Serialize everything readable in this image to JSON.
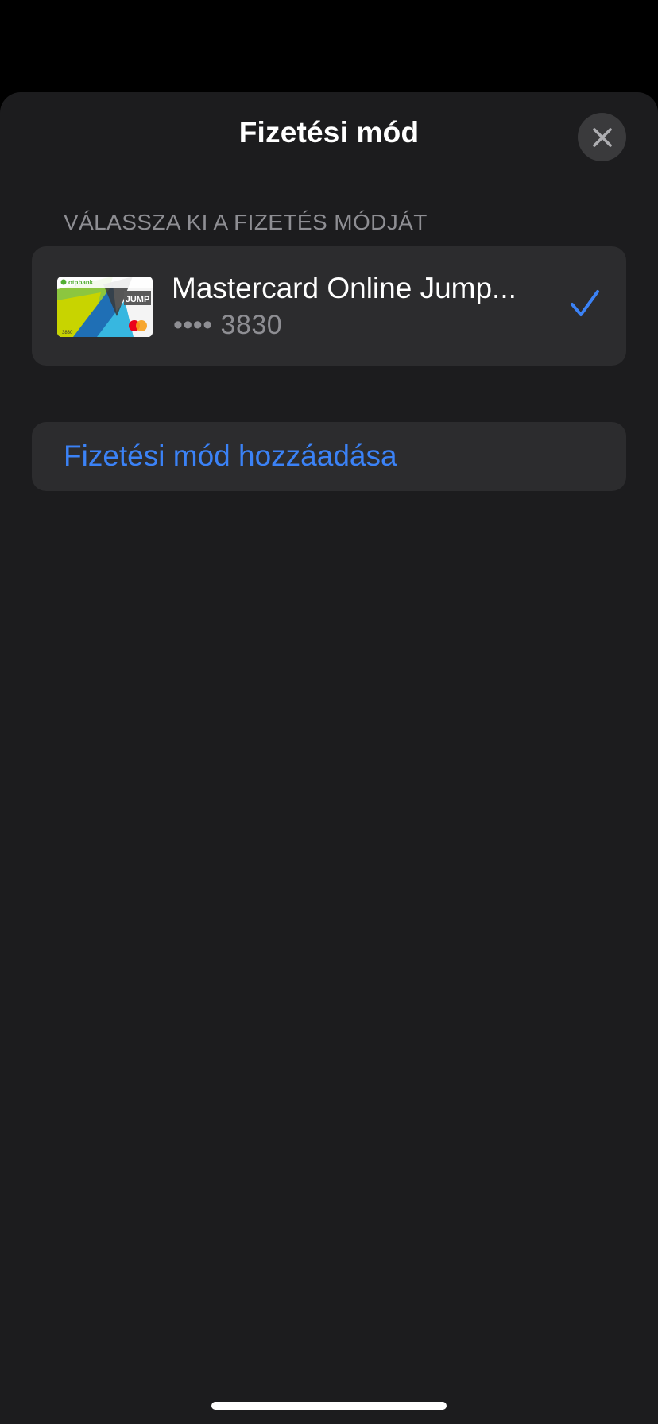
{
  "sheet": {
    "title": "Fizetési mód",
    "close_icon": "close-icon"
  },
  "payment": {
    "section_header": "VÁLASSZA KI A FIZETÉS MÓDJÁT",
    "methods": [
      {
        "name": "Mastercard Online Jump...",
        "number": "•••• 3830",
        "selected": true,
        "card_bank_logo": "otpbank",
        "card_brand_text": "JUMP",
        "card_small_number": "3830"
      }
    ],
    "add_label": "Fizetési mód hozzáadása"
  },
  "colors": {
    "background": "#000000",
    "sheet": "#1c1c1e",
    "row": "#2c2c2e",
    "accent": "#3b82f6",
    "secondary_text": "#8e8e93"
  }
}
